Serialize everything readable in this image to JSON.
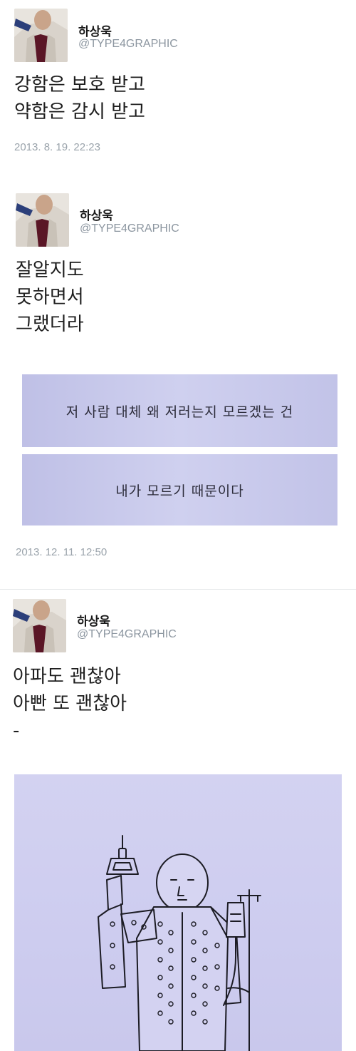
{
  "tweets": [
    {
      "name": "하상욱",
      "handle": "@TYPE4GRAPHIC",
      "text": "강함은 보호 받고\n약함은 감시 받고",
      "timestamp": "2013. 8. 19. 22:23"
    },
    {
      "name": "하상욱",
      "handle": "@TYPE4GRAPHIC",
      "text": "잘알지도\n못하면서\n그랬더라",
      "image_cards": [
        "저 사람 대체 왜 저러는지 모르겠는 건",
        "내가 모르기 때문이다"
      ],
      "timestamp": "2013. 12. 11. 12:50"
    },
    {
      "name": "하상욱",
      "handle": "@TYPE4GRAPHIC",
      "text": "아파도 괜찮아\n아빤 또 괜찮아\n-"
    }
  ],
  "drawing_icon": "patient-with-iv-pole-illustration"
}
